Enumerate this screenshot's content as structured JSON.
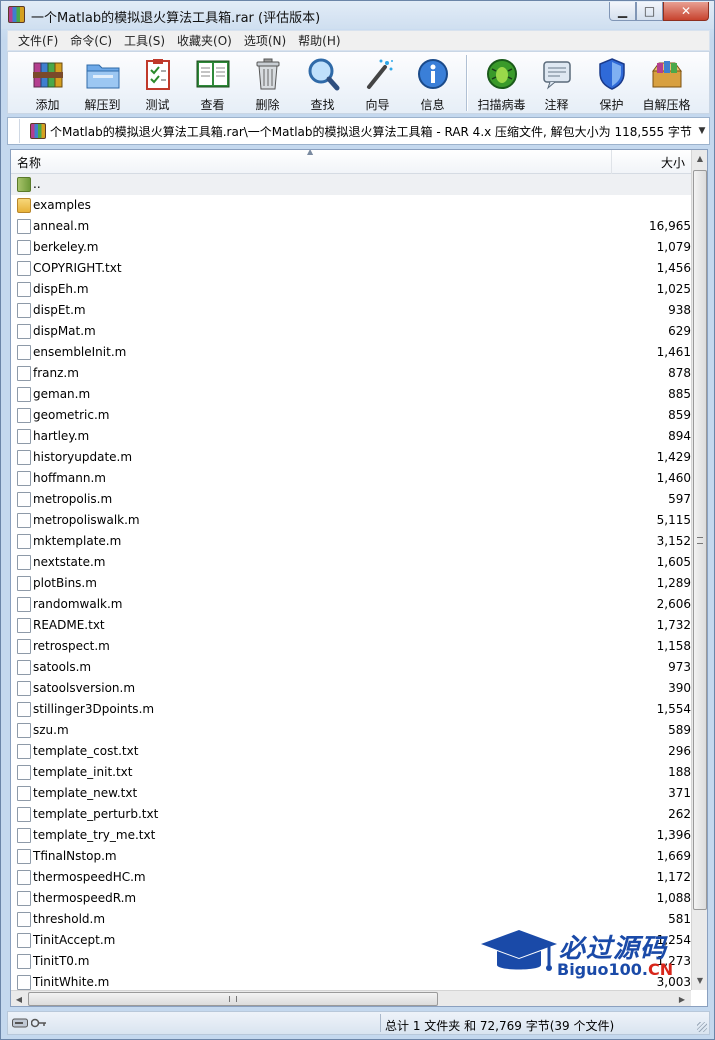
{
  "window": {
    "title": "一个Matlab的模拟退火算法工具箱.rar (评估版本)"
  },
  "menu": [
    "文件(F)",
    "命令(C)",
    "工具(S)",
    "收藏夹(O)",
    "选项(N)",
    "帮助(H)"
  ],
  "toolbar": {
    "add": "添加",
    "extract": "解压到",
    "test": "测试",
    "view": "查看",
    "delete": "删除",
    "find": "查找",
    "wizard": "向导",
    "info": "信息",
    "scan": "扫描病毒",
    "comment": "注释",
    "protect": "保护",
    "sfx": "自解压格"
  },
  "address": {
    "path": "个Matlab的模拟退火算法工具箱.rar\\一个Matlab的模拟退火算法工具箱 - RAR 4.x 压缩文件, 解包大小为 118,555 字节"
  },
  "columns": {
    "name": "名称",
    "size": "大小"
  },
  "files": [
    {
      "name": "..",
      "size": "",
      "kind": "up"
    },
    {
      "name": "examples",
      "size": "",
      "kind": "folder"
    },
    {
      "name": "anneal.m",
      "size": "16,965",
      "kind": "file"
    },
    {
      "name": "berkeley.m",
      "size": "1,079",
      "kind": "file"
    },
    {
      "name": "COPYRIGHT.txt",
      "size": "1,456",
      "kind": "file"
    },
    {
      "name": "dispEh.m",
      "size": "1,025",
      "kind": "file"
    },
    {
      "name": "dispEt.m",
      "size": "938",
      "kind": "file"
    },
    {
      "name": "dispMat.m",
      "size": "629",
      "kind": "file"
    },
    {
      "name": "ensembleInit.m",
      "size": "1,461",
      "kind": "file"
    },
    {
      "name": "franz.m",
      "size": "878",
      "kind": "file"
    },
    {
      "name": "geman.m",
      "size": "885",
      "kind": "file"
    },
    {
      "name": "geometric.m",
      "size": "859",
      "kind": "file"
    },
    {
      "name": "hartley.m",
      "size": "894",
      "kind": "file"
    },
    {
      "name": "historyupdate.m",
      "size": "1,429",
      "kind": "file"
    },
    {
      "name": "hoffmann.m",
      "size": "1,460",
      "kind": "file"
    },
    {
      "name": "metropolis.m",
      "size": "597",
      "kind": "file"
    },
    {
      "name": "metropoliswalk.m",
      "size": "5,115",
      "kind": "file"
    },
    {
      "name": "mktemplate.m",
      "size": "3,152",
      "kind": "file"
    },
    {
      "name": "nextstate.m",
      "size": "1,605",
      "kind": "file"
    },
    {
      "name": "plotBins.m",
      "size": "1,289",
      "kind": "file"
    },
    {
      "name": "randomwalk.m",
      "size": "2,606",
      "kind": "file"
    },
    {
      "name": "README.txt",
      "size": "1,732",
      "kind": "file"
    },
    {
      "name": "retrospect.m",
      "size": "1,158",
      "kind": "file"
    },
    {
      "name": "satools.m",
      "size": "973",
      "kind": "file"
    },
    {
      "name": "satoolsversion.m",
      "size": "390",
      "kind": "file"
    },
    {
      "name": "stillinger3Dpoints.m",
      "size": "1,554",
      "kind": "file"
    },
    {
      "name": "szu.m",
      "size": "589",
      "kind": "file"
    },
    {
      "name": "template_cost.txt",
      "size": "296",
      "kind": "file"
    },
    {
      "name": "template_init.txt",
      "size": "188",
      "kind": "file"
    },
    {
      "name": "template_new.txt",
      "size": "371",
      "kind": "file"
    },
    {
      "name": "template_perturb.txt",
      "size": "262",
      "kind": "file"
    },
    {
      "name": "template_try_me.txt",
      "size": "1,396",
      "kind": "file"
    },
    {
      "name": "TfinalNstop.m",
      "size": "1,669",
      "kind": "file"
    },
    {
      "name": "thermospeedHC.m",
      "size": "1,172",
      "kind": "file"
    },
    {
      "name": "thermospeedR.m",
      "size": "1,088",
      "kind": "file"
    },
    {
      "name": "threshold.m",
      "size": "581",
      "kind": "file"
    },
    {
      "name": "TinitAccept.m",
      "size": "1,254",
      "kind": "file"
    },
    {
      "name": "TinitT0.m",
      "size": "1,273",
      "kind": "file"
    },
    {
      "name": "TinitWhite.m",
      "size": "3,003",
      "kind": "file"
    }
  ],
  "status": {
    "summary": "总计 1 文件夹 和 72,769 字节(39 个文件)"
  },
  "watermark": {
    "cn": "必过源码",
    "en_prefix": "Biguo100.",
    "en_suffix": "CN"
  },
  "colors": {
    "title_bar": "#cfdff0",
    "selection": "#eef0f3",
    "watermark_blue": "#1a4aa8",
    "watermark_red": "#d8261a"
  }
}
